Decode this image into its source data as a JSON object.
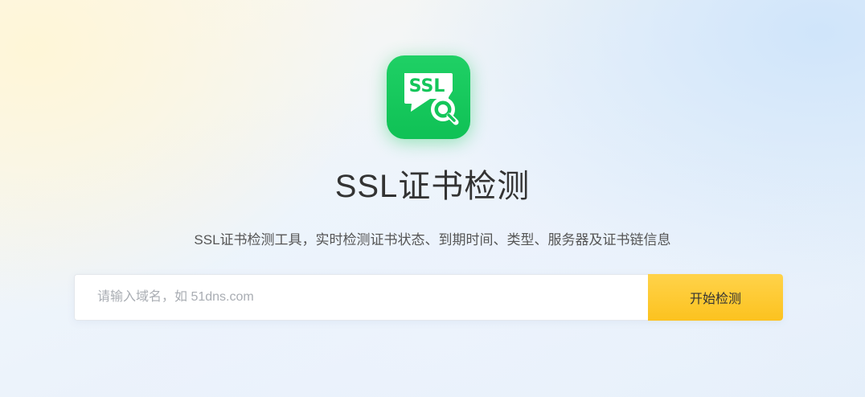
{
  "hero": {
    "icon_name": "ssl-search-icon",
    "icon_text": "SSL",
    "title": "SSL证书检测",
    "subtitle": "SSL证书检测工具，实时检测证书状态、到期时间、类型、服务器及证书链信息"
  },
  "search": {
    "placeholder": "请输入域名，如 51dns.com",
    "value": "",
    "button_label": "开始检测"
  },
  "colors": {
    "icon_green": "#14c65a",
    "button_yellow": "#fcc72c",
    "title_text": "#333333"
  }
}
